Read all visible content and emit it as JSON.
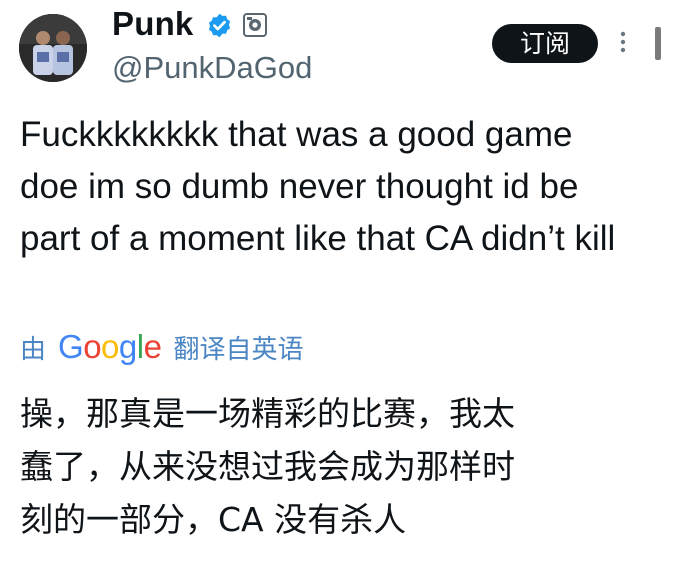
{
  "tweet": {
    "author": {
      "display_name": "Punk",
      "handle": "@PunkDaGod",
      "verified_icon": "verified-check-icon",
      "affiliate_icon": "affiliate-badge-icon",
      "verified_color": "#1d9bf0"
    },
    "subscribe_label": "订阅",
    "more_icon": "more-vertical-icon",
    "text": "Fuckkkkkkkk that was a good game doe im so dumb never thought id be part of a moment like that CA didn’t kill",
    "translation": {
      "prefix": "由",
      "provider_logo_text": "Google",
      "suffix": "翻译自英语",
      "link_color": "#4c86c4",
      "lines": [
        "操，那真是一场精彩的比赛，我太",
        "蠢了，从来没想过我会成为那样时",
        "刻的一部分，CA 没有杀人"
      ]
    }
  }
}
